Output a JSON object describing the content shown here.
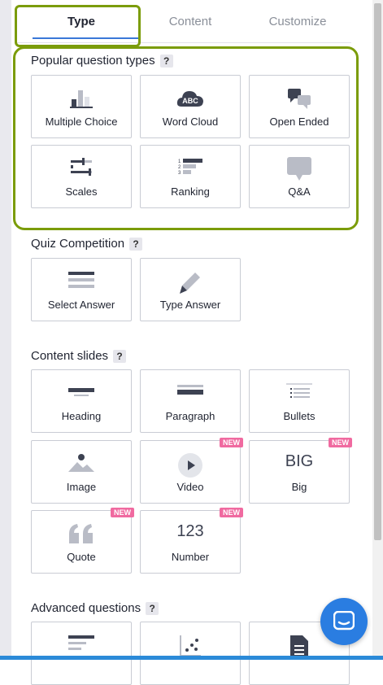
{
  "tabs": [
    {
      "label": "Type"
    },
    {
      "label": "Content"
    },
    {
      "label": "Customize"
    }
  ],
  "sections": {
    "popular": {
      "title": "Popular question types",
      "help": "?"
    },
    "quiz": {
      "title": "Quiz Competition",
      "help": "?"
    },
    "content": {
      "title": "Content slides",
      "help": "?"
    },
    "advanced": {
      "title": "Advanced questions",
      "help": "?"
    }
  },
  "popular_items": [
    {
      "label": "Multiple Choice",
      "icon": "bar-chart-icon"
    },
    {
      "label": "Word Cloud",
      "icon": "word-cloud-icon"
    },
    {
      "label": "Open Ended",
      "icon": "speech-bubbles-icon"
    },
    {
      "label": "Scales",
      "icon": "sliders-icon"
    },
    {
      "label": "Ranking",
      "icon": "ranking-icon"
    },
    {
      "label": "Q&A",
      "icon": "qa-bubble-icon"
    }
  ],
  "quiz_items": [
    {
      "label": "Select Answer",
      "icon": "list-lines-icon"
    },
    {
      "label": "Type Answer",
      "icon": "pencil-icon"
    }
  ],
  "content_items": [
    {
      "label": "Heading",
      "icon": "heading-icon"
    },
    {
      "label": "Paragraph",
      "icon": "paragraph-icon"
    },
    {
      "label": "Bullets",
      "icon": "bullets-icon"
    },
    {
      "label": "Image",
      "icon": "image-icon"
    },
    {
      "label": "Video",
      "icon": "play-icon",
      "badge": "NEW"
    },
    {
      "label": "Big",
      "icon_text": "BIG",
      "badge": "NEW"
    },
    {
      "label": "Quote",
      "icon": "quote-icon",
      "badge": "NEW"
    },
    {
      "label": "Number",
      "icon_text": "123",
      "badge": "NEW"
    }
  ],
  "word_cloud_icon_text": "ABC",
  "colors": {
    "accent": "#3a78d8",
    "highlight": "#7b9c0a",
    "badge": "#f06aa0",
    "icon": "#3d4252"
  }
}
